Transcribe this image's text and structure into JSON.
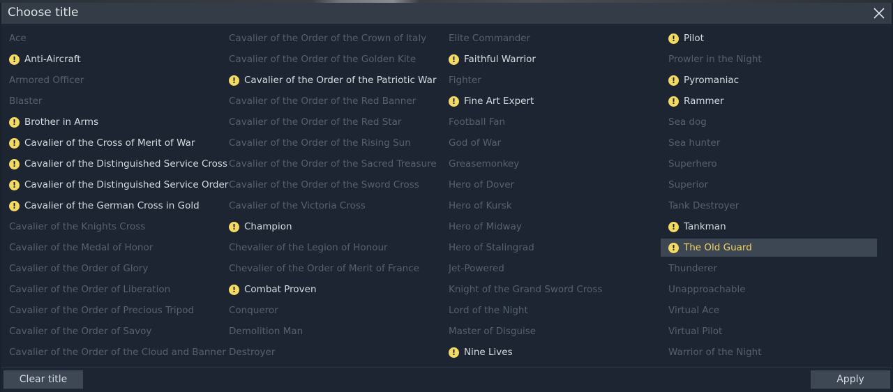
{
  "dialog": {
    "title": "Choose title",
    "clear_label": "Clear title",
    "apply_label": "Apply",
    "colors": {
      "unlocked_icon": "#f3da63",
      "selected_text": "#f2d261",
      "locked_text": "#566170"
    }
  },
  "columns": [
    {
      "items": [
        {
          "label": "Ace",
          "unlocked": false
        },
        {
          "label": "Anti-Aircraft",
          "unlocked": true
        },
        {
          "label": "Armored Officer",
          "unlocked": false
        },
        {
          "label": "Blaster",
          "unlocked": false
        },
        {
          "label": "Brother in Arms",
          "unlocked": true
        },
        {
          "label": "Cavalier of the Cross of Merit of War",
          "unlocked": true
        },
        {
          "label": "Cavalier of the Distinguished Service Cross",
          "unlocked": true
        },
        {
          "label": "Cavalier of the Distinguished Service Order",
          "unlocked": true
        },
        {
          "label": "Cavalier of the German Cross in Gold",
          "unlocked": true
        },
        {
          "label": "Cavalier of the Knights Cross",
          "unlocked": false
        },
        {
          "label": "Cavalier of the Medal of Honor",
          "unlocked": false
        },
        {
          "label": "Cavalier of the Order of Glory",
          "unlocked": false
        },
        {
          "label": "Cavalier of the Order of Liberation",
          "unlocked": false
        },
        {
          "label": "Cavalier of the Order of Precious Tripod",
          "unlocked": false
        },
        {
          "label": "Cavalier of the Order of Savoy",
          "unlocked": false
        },
        {
          "label": "Cavalier of the Order of the Cloud and Banner",
          "unlocked": false
        }
      ]
    },
    {
      "items": [
        {
          "label": "Cavalier of the Order of the Crown of Italy",
          "unlocked": false
        },
        {
          "label": "Cavalier of the Order of the Golden Kite",
          "unlocked": false
        },
        {
          "label": "Cavalier of the Order of the Patriotic War",
          "unlocked": true
        },
        {
          "label": "Cavalier of the Order of the Red Banner",
          "unlocked": false
        },
        {
          "label": "Cavalier of the Order of the Red Star",
          "unlocked": false
        },
        {
          "label": "Cavalier of the Order of the Rising Sun",
          "unlocked": false
        },
        {
          "label": "Cavalier of the Order of the Sacred Treasure",
          "unlocked": false
        },
        {
          "label": "Cavalier of the Order of the Sword Cross",
          "unlocked": false
        },
        {
          "label": "Cavalier of the Victoria Cross",
          "unlocked": false
        },
        {
          "label": "Champion",
          "unlocked": true
        },
        {
          "label": "Chevalier of the Legion of Honour",
          "unlocked": false
        },
        {
          "label": "Chevalier of the Order of Merit of France",
          "unlocked": false
        },
        {
          "label": "Combat Proven",
          "unlocked": true
        },
        {
          "label": "Conqueror",
          "unlocked": false
        },
        {
          "label": "Demolition Man",
          "unlocked": false
        },
        {
          "label": "Destroyer",
          "unlocked": false
        }
      ]
    },
    {
      "items": [
        {
          "label": "Elite Commander",
          "unlocked": false
        },
        {
          "label": "Faithful Warrior",
          "unlocked": true
        },
        {
          "label": "Fighter",
          "unlocked": false
        },
        {
          "label": "Fine Art Expert",
          "unlocked": true
        },
        {
          "label": "Football Fan",
          "unlocked": false
        },
        {
          "label": "God of War",
          "unlocked": false
        },
        {
          "label": "Greasemonkey",
          "unlocked": false
        },
        {
          "label": "Hero of Dover",
          "unlocked": false
        },
        {
          "label": "Hero of Kursk",
          "unlocked": false
        },
        {
          "label": "Hero of Midway",
          "unlocked": false
        },
        {
          "label": "Hero of Stalingrad",
          "unlocked": false
        },
        {
          "label": "Jet-Powered",
          "unlocked": false
        },
        {
          "label": "Knight of the Grand Sword Cross",
          "unlocked": false
        },
        {
          "label": "Lord of the Night",
          "unlocked": false
        },
        {
          "label": "Master of Disguise",
          "unlocked": false
        },
        {
          "label": "Nine Lives",
          "unlocked": true
        }
      ]
    },
    {
      "items": [
        {
          "label": "Pilot",
          "unlocked": true
        },
        {
          "label": "Prowler in the Night",
          "unlocked": false
        },
        {
          "label": "Pyromaniac",
          "unlocked": true
        },
        {
          "label": "Rammer",
          "unlocked": true
        },
        {
          "label": "Sea dog",
          "unlocked": false
        },
        {
          "label": "Sea hunter",
          "unlocked": false
        },
        {
          "label": "Superhero",
          "unlocked": false
        },
        {
          "label": "Superior",
          "unlocked": false
        },
        {
          "label": "Tank Destroyer",
          "unlocked": false
        },
        {
          "label": "Tankman",
          "unlocked": true
        },
        {
          "label": "The Old Guard",
          "unlocked": true,
          "selected": true
        },
        {
          "label": "Thunderer",
          "unlocked": false
        },
        {
          "label": "Unapproachable",
          "unlocked": false
        },
        {
          "label": "Virtual Ace",
          "unlocked": false
        },
        {
          "label": "Virtual Pilot",
          "unlocked": false
        },
        {
          "label": "Warrior of the Night",
          "unlocked": false
        }
      ]
    }
  ]
}
